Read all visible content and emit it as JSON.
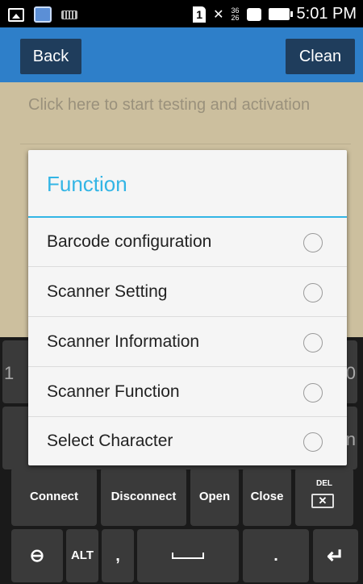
{
  "status_bar": {
    "left_icons": [
      "picture-icon",
      "app-notification-icon",
      "keyboard-icon"
    ],
    "sim_label": "1",
    "network_top": "36",
    "network_bottom": "26",
    "time": "5:01 PM"
  },
  "action_bar": {
    "back_label": "Back",
    "clean_label": "Clean",
    "background_color": "#2e7fc9"
  },
  "content": {
    "hint_text": "Click here to start testing and activation",
    "background_color": "#ccbf9e"
  },
  "dialog": {
    "title": "Function",
    "accent_color": "#33b5e5",
    "items": [
      {
        "label": "Barcode configuration"
      },
      {
        "label": "Scanner Setting"
      },
      {
        "label": "Scanner Information"
      },
      {
        "label": "Scanner Function"
      },
      {
        "label": "Select Character"
      }
    ]
  },
  "keyboard": {
    "row1_left_partial": "1",
    "row1_right_partial": "0",
    "row2_right_partial": "n",
    "row3": {
      "connect": "Connect",
      "disconnect": "Disconnect",
      "open": "Open",
      "close": "Close",
      "del": "DEL"
    },
    "row4": {
      "alt": "ALT",
      "comma": ",",
      "period": "."
    }
  }
}
